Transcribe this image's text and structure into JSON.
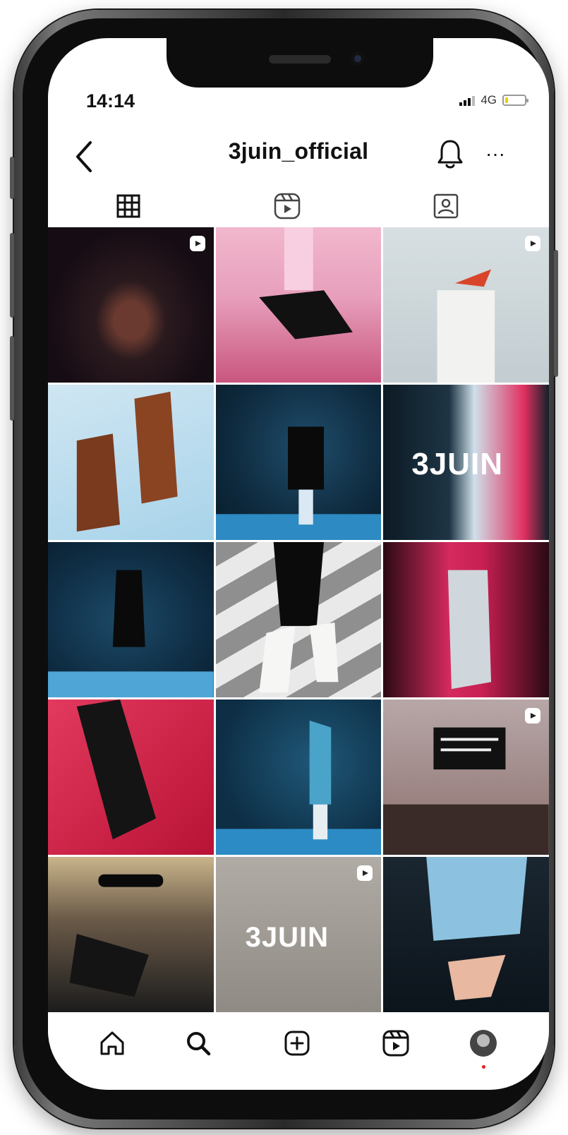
{
  "status": {
    "time": "14:14",
    "network": "4G"
  },
  "header": {
    "username": "3juin_official"
  },
  "tabs": [
    {
      "name": "posts-grid",
      "active": true
    },
    {
      "name": "reels",
      "active": false
    },
    {
      "name": "tagged",
      "active": false
    }
  ],
  "grid": {
    "brand_text_1": "3JUIN",
    "brand_text_2": "3JUIN",
    "reel_badges": [
      0,
      2,
      11,
      13
    ]
  },
  "icons": [
    "back-arrow-icon",
    "bell-icon",
    "more-icon",
    "grid-icon",
    "reels-icon",
    "tagged-icon",
    "home-icon",
    "search-icon",
    "create-icon",
    "reels-nav-icon",
    "avatar"
  ],
  "colors": {
    "text": "#111111",
    "notification_dot": "#e02020"
  }
}
